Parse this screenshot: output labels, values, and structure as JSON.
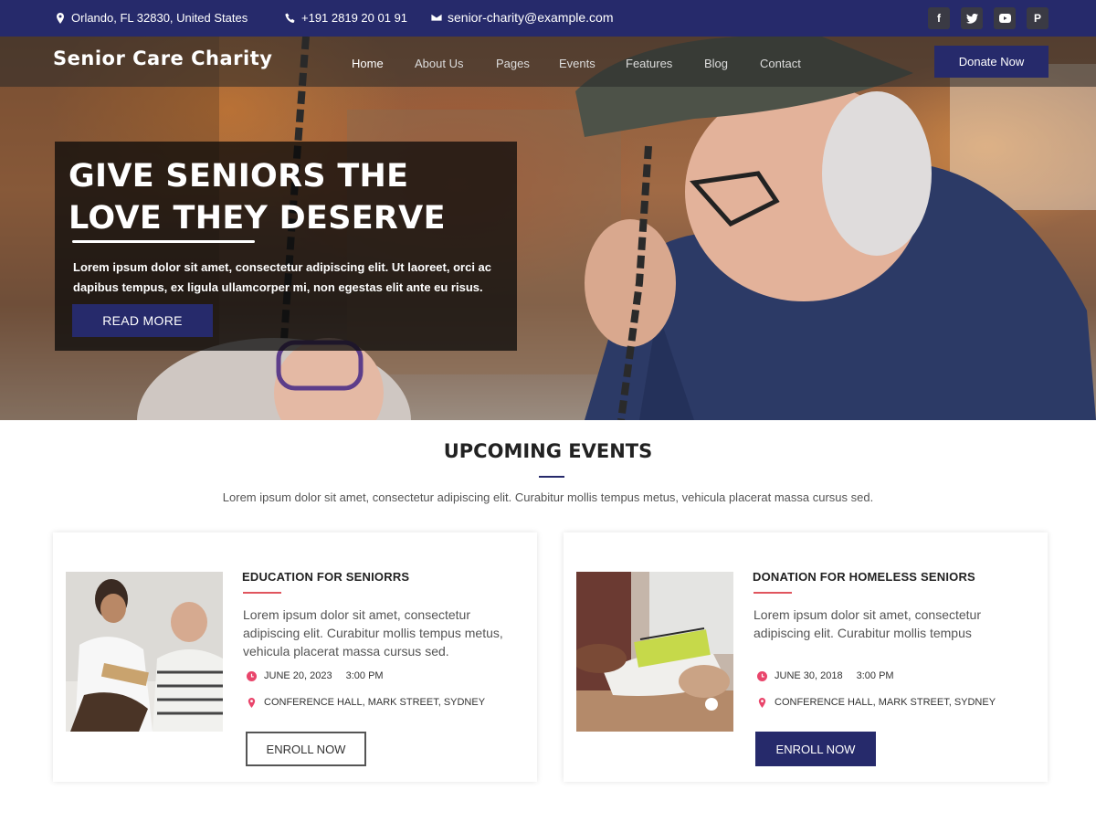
{
  "topbar": {
    "address": "Orlando, FL 32830, United States",
    "phone": "+191 2819 20 01 91",
    "email": "senior-charity@example.com",
    "socials": [
      "facebook-icon",
      "twitter-icon",
      "youtube-icon",
      "pinterest-icon"
    ]
  },
  "header": {
    "logo": "Senior Care Charity",
    "nav": [
      "Home",
      "About Us",
      "Pages",
      "Events",
      "Features",
      "Blog",
      "Contact"
    ],
    "donate_label": "Donate Now"
  },
  "hero": {
    "title_line1": "GIVE SENIORS THE",
    "title_line2": "LOVE THEY DESERVE",
    "text": "Lorem ipsum dolor sit amet, consectetur adipiscing elit. Ut laoreet, orci ac dapibus tempus, ex ligula ullamcorper mi, non egestas elit ante eu risus.",
    "button": "READ MORE"
  },
  "events": {
    "title": "UPCOMING EVENTS",
    "subtitle": "Lorem ipsum dolor sit amet, consectetur adipiscing elit. Curabitur mollis tempus metus, vehicula placerat massa cursus sed.",
    "items": [
      {
        "title": "EDUCATION FOR SENIORRS",
        "desc": "Lorem ipsum dolor sit amet, consectetur adipiscing elit. Curabitur mollis tempus metus, vehicula placerat massa cursus sed.",
        "date": "JUNE 20, 2023",
        "time": "3:00 PM",
        "location": "CONFERENCE HALL, MARK STREET, SYDNEY",
        "button": "ENROLL NOW"
      },
      {
        "title": "DONATION FOR HOMELESS SENIORS",
        "desc": "Lorem ipsum dolor sit amet, consectetur adipiscing elit. Curabitur mollis tempus",
        "date": "JUNE 30, 2018",
        "time": "3:00 PM",
        "location": "CONFERENCE HALL, MARK STREET, SYDNEY",
        "button": "ENROLL NOW"
      }
    ]
  },
  "colors": {
    "brand": "#262a6b",
    "accent": "#e0555e",
    "icon_pink": "#e9456b"
  }
}
